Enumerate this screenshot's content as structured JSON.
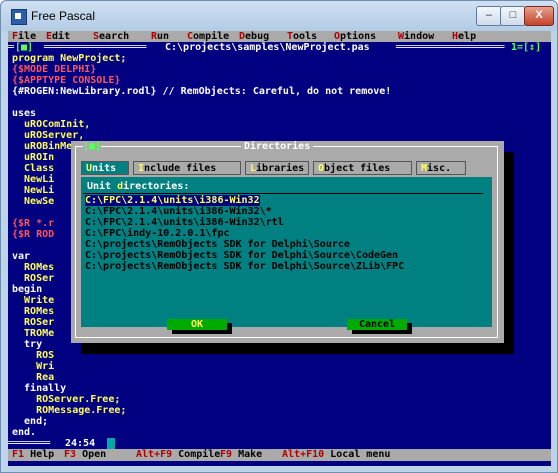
{
  "window": {
    "title": "Free Pascal",
    "min_icon": "minimize-icon",
    "max_icon": "maximize-icon",
    "close_icon": "close-icon",
    "min_glyph": "–",
    "max_glyph": "□",
    "close_glyph": "X"
  },
  "menu": [
    {
      "label": "File",
      "hk": "F",
      "rest": "ile"
    },
    {
      "label": "Edit",
      "hk": "E",
      "rest": "dit"
    },
    {
      "label": "Search",
      "hk": "S",
      "rest": "earch"
    },
    {
      "label": "Run",
      "hk": "R",
      "rest": "un"
    },
    {
      "label": "Compile",
      "hk": "C",
      "rest": "ompile"
    },
    {
      "label": "Debug",
      "hk": "D",
      "rest": "ebug"
    },
    {
      "label": "Tools",
      "hk": "T",
      "rest": "ools"
    },
    {
      "label": "Options",
      "hk": "O",
      "rest": "ptions"
    },
    {
      "label": "Window",
      "hk": "W",
      "rest": "indow"
    },
    {
      "label": "Help",
      "hk": "H",
      "rest": "elp"
    }
  ],
  "editor": {
    "close_box": "[■]",
    "file_path": "C:\\projects\\samples\\NewProject.pas",
    "window_number": "1=[↕]",
    "cursor_pos": "24:54",
    "lines": [
      {
        "text": "program NewProject;",
        "cls": "y"
      },
      {
        "text": "{$MODE DELPHI}",
        "cls": "r"
      },
      {
        "text": "{$APPTYPE CONSOLE}",
        "cls": "r"
      },
      {
        "text": "{#ROGEN:NewLibrary.rodl} // RemObjects: Careful, do not remove!",
        "cls": "w"
      },
      {
        "text": "",
        "cls": "w"
      },
      {
        "text": "uses",
        "cls": "w"
      },
      {
        "text": "  uROComInit,",
        "cls": "y"
      },
      {
        "text": "  uROServer,",
        "cls": "y"
      },
      {
        "text": "  uROBinMessage,",
        "cls": "y"
      },
      {
        "text": "  uROIn",
        "cls": "y"
      },
      {
        "text": "  Class",
        "cls": "y"
      },
      {
        "text": "  NewLi",
        "cls": "y"
      },
      {
        "text": "  NewLi",
        "cls": "y"
      },
      {
        "text": "  NewSe",
        "cls": "y"
      },
      {
        "text": "",
        "cls": "w"
      },
      {
        "text": "{$R *.r",
        "cls": "r"
      },
      {
        "text": "{$R ROD",
        "cls": "r"
      },
      {
        "text": "",
        "cls": "w"
      },
      {
        "text": "var",
        "cls": "w"
      },
      {
        "text": "  ROMes",
        "cls": "y"
      },
      {
        "text": "  ROSer",
        "cls": "y"
      },
      {
        "text": "begin",
        "cls": "w"
      },
      {
        "text": "  Write",
        "cls": "y"
      },
      {
        "text": "  ROMes",
        "cls": "y"
      },
      {
        "text": "  ROSer",
        "cls": "y"
      },
      {
        "text": "  TROMe",
        "cls": "y"
      },
      {
        "text": "  try",
        "cls": "w"
      },
      {
        "text": "    ROS",
        "cls": "y"
      },
      {
        "text": "    Wri",
        "cls": "y"
      },
      {
        "text": "    Rea",
        "cls": "y"
      },
      {
        "text": "  finally",
        "cls": "w"
      },
      {
        "text": "    ROServer.Free;",
        "cls": "y"
      },
      {
        "text": "    ROMessage.Free;",
        "cls": "y"
      },
      {
        "text": "  end;",
        "cls": "w"
      },
      {
        "text": "end.",
        "cls": "w"
      }
    ]
  },
  "dialog": {
    "title": "Directories",
    "close_box": "[■]",
    "tabs": [
      {
        "hk": "U",
        "rest": "nits",
        "selected": true
      },
      {
        "hk": "I",
        "rest": "nclude files",
        "selected": false
      },
      {
        "hk": "L",
        "rest": "ibraries",
        "selected": false
      },
      {
        "hk": "O",
        "rest": "bject files",
        "selected": false
      },
      {
        "hk": "M",
        "rest": "isc.",
        "selected": false
      }
    ],
    "label_pre": "Unit ",
    "label_hk": "d",
    "label_post": "irectories:",
    "directories": [
      "C:\\FPC\\2.1.4\\units\\i386-Win32",
      "C:\\FPC\\2.1.4\\units\\i386-Win32\\*",
      "C:\\FPC\\2.1.4\\units\\i386-Win32\\rtl",
      "C:\\FPC\\indy-10.2.0.1\\fpc",
      "C:\\projects\\RemObjects SDK for Delphi\\Source",
      "C:\\projects\\RemObjects SDK for Delphi\\Source\\CodeGen",
      "C:\\projects\\RemObjects SDK for Delphi\\Source\\ZLib\\FPC"
    ],
    "ok_label": "OK",
    "cancel_label": "Cancel"
  },
  "status": {
    "items": [
      {
        "key": "F1",
        "label": "Help"
      },
      {
        "key": "F3",
        "label": "Open"
      },
      {
        "key": "Alt+F9",
        "label": "Compile"
      },
      {
        "key": "F9",
        "label": "Make"
      },
      {
        "key": "Alt+F10",
        "label": "Local menu"
      }
    ]
  }
}
